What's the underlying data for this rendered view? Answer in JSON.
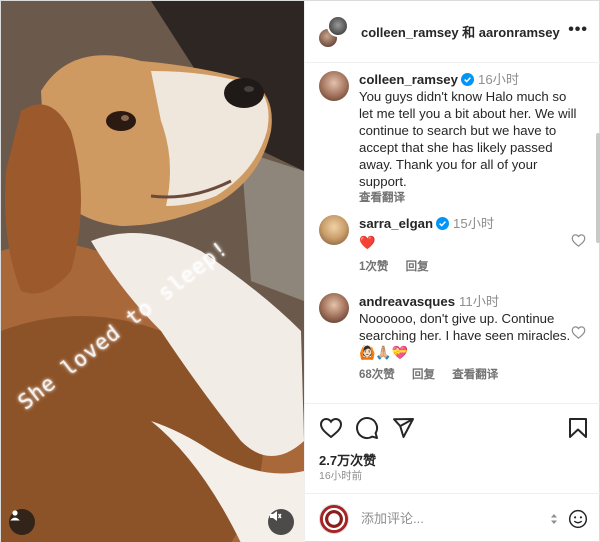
{
  "photo": {
    "overlay_text": "She loved to sleep!",
    "tag_icon": "person-tag-icon",
    "mute_icon": "speaker-mute-icon"
  },
  "header": {
    "title": "colleen_ramsey 和 aaronramsey",
    "more_icon": "more-horizontal-icon"
  },
  "comments": [
    {
      "username": "colleen_ramsey",
      "verified": true,
      "time": "16小时",
      "text": "You guys didn't know Halo much so let me tell you a bit about her. We will continue to search but we have to accept that she has likely passed away. Thank you for all of your support.",
      "translate": "查看翻译"
    },
    {
      "username": "sarra_elgan",
      "verified": true,
      "time": "15小时",
      "text": "❤️",
      "likes": "1次赞",
      "reply": "回复"
    },
    {
      "username": "andreavasques",
      "verified": false,
      "time": "11小时",
      "text": "Noooooo, don't give up. Continue searching her. I have seen miracles. 🙆🏻🙏🏼💝",
      "likes": "68次赞",
      "reply": "回复",
      "translate": "查看翻译"
    }
  ],
  "actions": {
    "like_icon": "heart-icon",
    "comment_icon": "comment-icon",
    "share_icon": "share-icon",
    "save_icon": "bookmark-icon",
    "likes_count": "2.7万次赞",
    "posted_ago": "16小时前"
  },
  "composer": {
    "placeholder": "添加评论...",
    "emoji_icon": "smiley-icon"
  },
  "colors": {
    "verified_blue": "#0095f6",
    "heart_red": "#ed4956",
    "muted_text": "#8e8e8e",
    "border": "#efefef"
  }
}
